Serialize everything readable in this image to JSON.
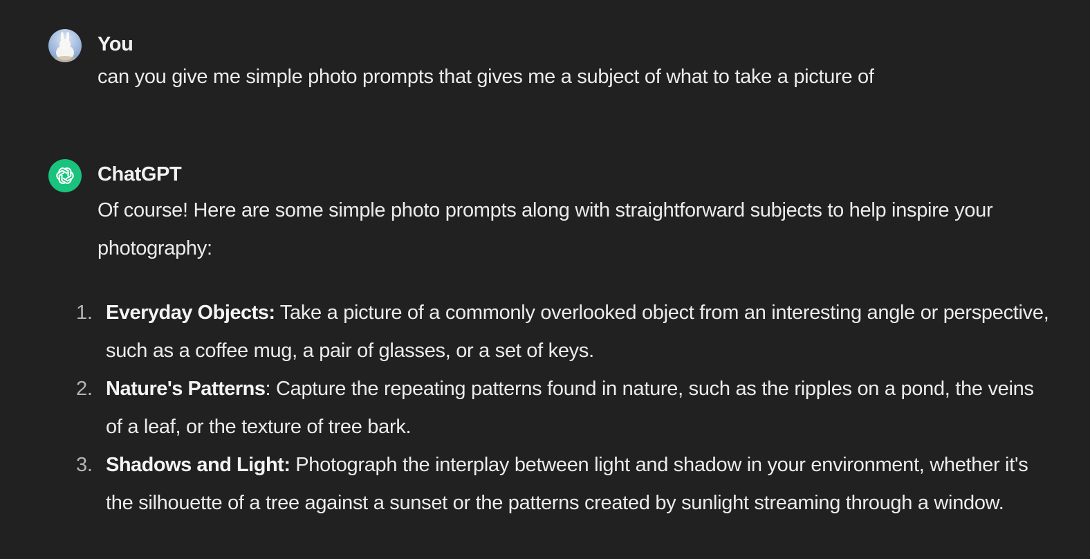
{
  "conversation": {
    "user_message": {
      "author": "You",
      "avatar_icon": "user-avatar-image",
      "text": "can you give me simple photo prompts that gives me a subject of what to take a picture of"
    },
    "assistant_message": {
      "author": "ChatGPT",
      "avatar_icon": "openai-logo-icon",
      "avatar_color": "#19c37d",
      "intro": "Of course! Here are some simple photo prompts along with straightforward subjects to help inspire your photography:",
      "items": [
        {
          "number": "1.",
          "title": "Everyday Objects:",
          "text": " Take a picture of a commonly overlooked object from an interesting angle or perspective, such as a coffee mug, a pair of glasses, or a set of keys."
        },
        {
          "number": "2.",
          "title": "Nature's Patterns",
          "text": ": Capture the repeating patterns found in nature, such as the ripples on a pond, the veins of a leaf, or the texture of tree bark."
        },
        {
          "number": "3.",
          "title": "Shadows and Light:",
          "text": " Photograph the interplay between light and shadow in your environment, whether it's the silhouette of a tree against a sunset or the patterns created by sunlight streaming through a window."
        }
      ]
    }
  },
  "colors": {
    "background": "#212121",
    "text": "#ececec",
    "list_number": "#b4b4b4",
    "gpt_brand": "#19c37d"
  }
}
